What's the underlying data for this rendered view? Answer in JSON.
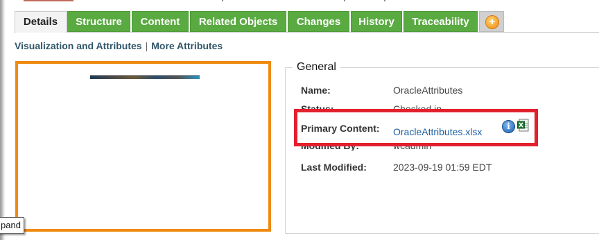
{
  "tabs": [
    {
      "label": "Details",
      "active": true
    },
    {
      "label": "Structure"
    },
    {
      "label": "Content"
    },
    {
      "label": "Related Objects"
    },
    {
      "label": "Changes"
    },
    {
      "label": "History"
    },
    {
      "label": "Traceability"
    }
  ],
  "add_tab_icon": "plus-circle",
  "subnav": {
    "visualization": "Visualization and Attributes",
    "separator": "|",
    "more": "More Attributes"
  },
  "tooltip": "pand",
  "general": {
    "legend": "General",
    "name_label": "Name:",
    "name_value": "OracleAttributes",
    "status_label": "Status:",
    "status_value": "Checked in",
    "primary_label": "Primary Content:",
    "primary_value": "OracleAttributes.xlsx",
    "modified_by_label": "Modified By:",
    "modified_by_value": "wcadmin",
    "last_modified_label": "Last Modified:",
    "last_modified_value": "2023-09-19 01:59 EDT"
  },
  "colors": {
    "tab_green": "#5aaa42",
    "viewer_border": "#ef8a10",
    "highlight": "#e3202e",
    "link": "#1f5fa0"
  }
}
